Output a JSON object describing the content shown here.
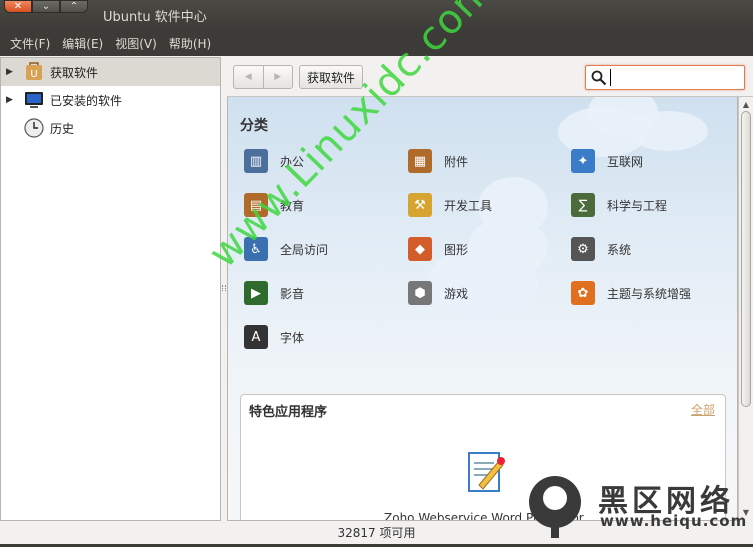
{
  "window": {
    "title": "Ubuntu 软件中心"
  },
  "menubar": [
    "文件(F)",
    "编辑(E)",
    "视图(V)",
    "帮助(H)"
  ],
  "sidebar": {
    "items": [
      {
        "label": "获取软件",
        "icon": "software-center-icon",
        "expander": true,
        "selected": true
      },
      {
        "label": "已安装的软件",
        "icon": "computer-icon",
        "expander": true,
        "selected": false
      },
      {
        "label": "历史",
        "icon": "clock-icon",
        "expander": false,
        "selected": false
      }
    ]
  },
  "toolbar": {
    "back_glyph": "◀",
    "forward_glyph": "▶",
    "breadcrumb": "获取软件",
    "search_placeholder": ""
  },
  "main": {
    "section_title": "分类",
    "categories": [
      {
        "label": "办公",
        "icon": "office-icon",
        "color": "#4a6f9c"
      },
      {
        "label": "附件",
        "icon": "accessories-icon",
        "color": "#b06a2a"
      },
      {
        "label": "互联网",
        "icon": "internet-icon",
        "color": "#3a7cc7"
      },
      {
        "label": "教育",
        "icon": "education-icon",
        "color": "#b06a2a"
      },
      {
        "label": "开发工具",
        "icon": "developer-tools-icon",
        "color": "#d8a431"
      },
      {
        "label": "科学与工程",
        "icon": "science-icon",
        "color": "#4c6b3b"
      },
      {
        "label": "全局访问",
        "icon": "accessibility-icon",
        "color": "#3a6fb0"
      },
      {
        "label": "图形",
        "icon": "graphics-icon",
        "color": "#d25d2a"
      },
      {
        "label": "系统",
        "icon": "system-icon",
        "color": "#555555"
      },
      {
        "label": "影音",
        "icon": "multimedia-icon",
        "color": "#2f6b2f"
      },
      {
        "label": "游戏",
        "icon": "games-icon",
        "color": "#777777"
      },
      {
        "label": "主题与系统增强",
        "icon": "themes-icon",
        "color": "#e07020"
      },
      {
        "label": "字体",
        "icon": "fonts-icon",
        "color": "#333333"
      }
    ],
    "featured": {
      "title": "特色应用程序",
      "all_link": "全部",
      "app_name": "Zoho Webservice Word Processor"
    }
  },
  "status": {
    "text": "32817 项可用"
  },
  "watermark": {
    "diagonal": "www.Linuxidc.com",
    "logo_text": "黑区网络",
    "logo_url": "www.heiqu.com"
  }
}
